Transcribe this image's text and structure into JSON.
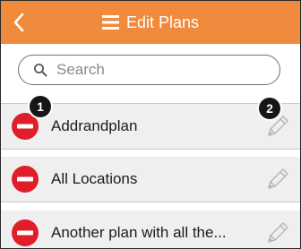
{
  "header": {
    "title": "Edit Plans"
  },
  "search": {
    "placeholder": "Search"
  },
  "plans": [
    {
      "name": "Addrandplan"
    },
    {
      "name": "All Locations"
    },
    {
      "name": "Another plan with all the..."
    }
  ],
  "annotations": {
    "badge_1": "1",
    "badge_2": "2"
  },
  "colors": {
    "header_bg": "#f08a3c",
    "delete_red": "#e01e2a",
    "row_bg": "#efefef"
  }
}
